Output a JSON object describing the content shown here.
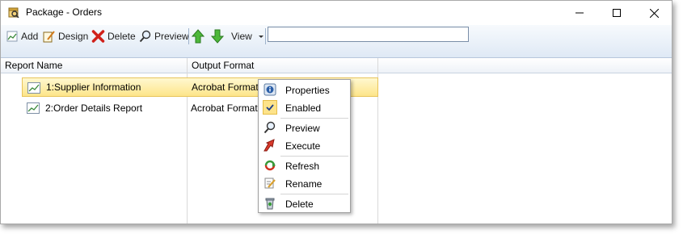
{
  "window": {
    "title": "Package - Orders"
  },
  "toolbar": {
    "add_label": "Add",
    "design_label": "Design",
    "delete_label": "Delete",
    "preview_label": "Preview",
    "view_label": "View",
    "search_value": ""
  },
  "grid": {
    "columns": [
      "Report Name",
      "Output Format"
    ],
    "rows": [
      {
        "name": "1:Supplier Information",
        "format": "Acrobat Format (",
        "selected": true
      },
      {
        "name": "2:Order Details Report",
        "format": "Acrobat Format (",
        "selected": false
      }
    ]
  },
  "context_menu": {
    "items": [
      {
        "label": "Properties",
        "icon": "info-icon"
      },
      {
        "label": "Enabled",
        "icon": "check-icon",
        "checked": true
      },
      {
        "label": "Preview",
        "icon": "magnifier-icon"
      },
      {
        "label": "Execute",
        "icon": "execute-arrow-icon"
      },
      {
        "label": "Refresh",
        "icon": "refresh-icon"
      },
      {
        "label": "Rename",
        "icon": "rename-pencil-icon"
      },
      {
        "label": "Delete",
        "icon": "trash-icon"
      }
    ]
  },
  "colors": {
    "selection_fill": "#fde58a",
    "selection_border": "#e8c45a",
    "toolbar_gradient_top": "#f7fafd",
    "toolbar_gradient_bottom": "#dfe9f5"
  }
}
